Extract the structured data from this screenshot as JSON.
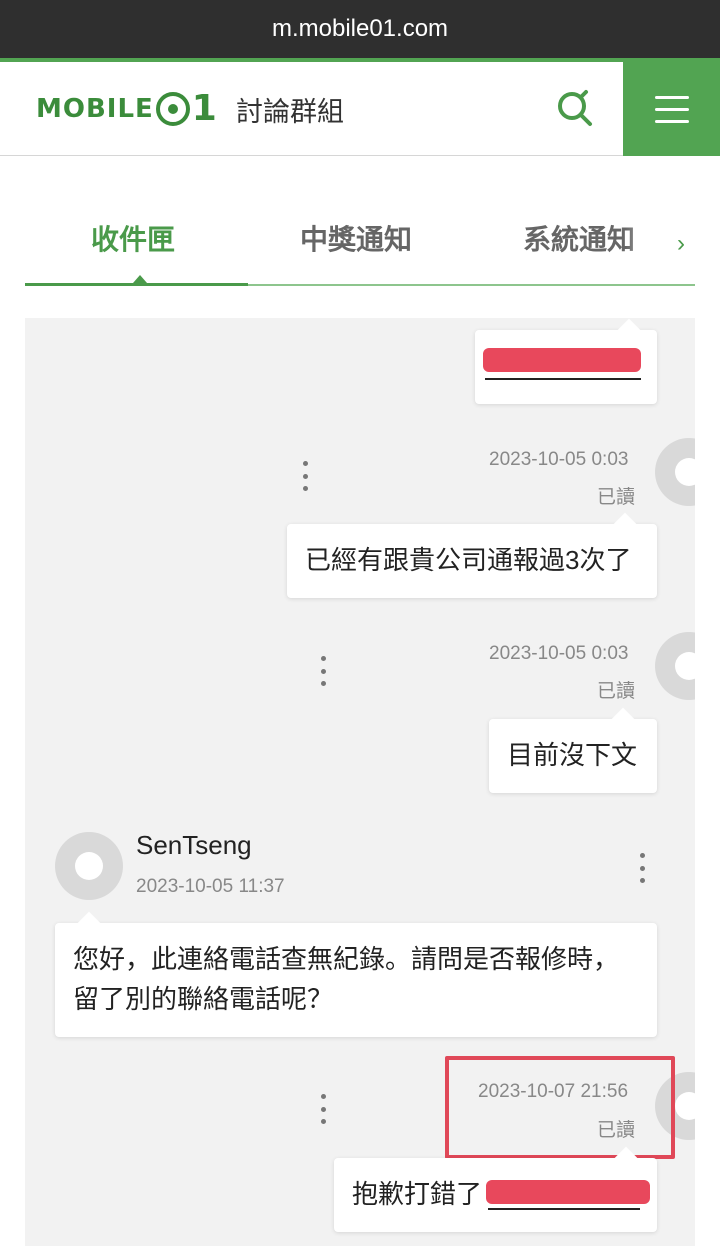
{
  "browser": {
    "url": "m.mobile01.com"
  },
  "header": {
    "logo_text": "MOBILE",
    "logo_num": "1",
    "forum_title": "討論群組",
    "search_icon": "search-icon",
    "menu_icon": "hamburger-menu-icon"
  },
  "tabs": [
    {
      "label": "收件匣",
      "active": true
    },
    {
      "label": "中獎通知",
      "active": false
    },
    {
      "label": "系統通知",
      "active": false
    }
  ],
  "messages": [
    {
      "side": "right",
      "text": "",
      "redacted": true
    },
    {
      "side": "right",
      "time": "2023-10-05 0:03",
      "status": "已讀",
      "text": "已經有跟貴公司通報過3次了"
    },
    {
      "side": "right",
      "time": "2023-10-05 0:03",
      "status": "已讀",
      "text": "目前沒下文"
    },
    {
      "side": "left",
      "user": "SenTseng",
      "time": "2023-10-05 11:37",
      "text_line1": "您好，此連絡電話查無紀錄。請問是否報修時，",
      "text_line2": "留了別的聯絡電話呢？"
    },
    {
      "side": "right",
      "time": "2023-10-07 21:56",
      "status": "已讀",
      "text": "抱歉打錯了",
      "redacted": true
    }
  ],
  "colors": {
    "brand_green": "#52a452",
    "highlight_red": "#e04858",
    "redaction": "#e8485c"
  }
}
